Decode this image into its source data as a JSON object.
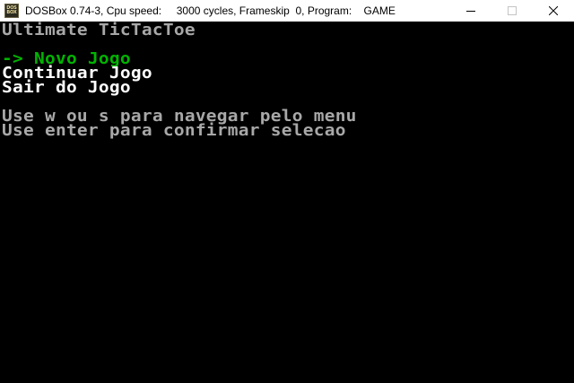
{
  "window": {
    "title": "DOSBox 0.74-3, Cpu speed:     3000 cycles, Frameskip  0, Program:    GAME",
    "icon_name": "dosbox-icon",
    "icon_label_top": "DOS",
    "icon_label_bottom": "BOX",
    "controls": {
      "minimize_icon": "minimize-icon",
      "maximize_icon": "maximize-icon",
      "close_icon": "close-icon"
    }
  },
  "game": {
    "title": "Ultimate TicTacToe",
    "menu": {
      "selected_prefix": "->",
      "items": [
        {
          "label": "Novo Jogo",
          "selected": true
        },
        {
          "label": "Continuar Jogo",
          "selected": false
        },
        {
          "label": "Sair do Jogo",
          "selected": false
        }
      ]
    },
    "instructions": [
      "Use w ou s para navegar pelo menu",
      "Use enter para confirmar selecao"
    ]
  },
  "colors": {
    "background": "#000000",
    "text_default": "#a8a8a8",
    "text_highlight": "#ffffff",
    "text_selected": "#00b400"
  }
}
